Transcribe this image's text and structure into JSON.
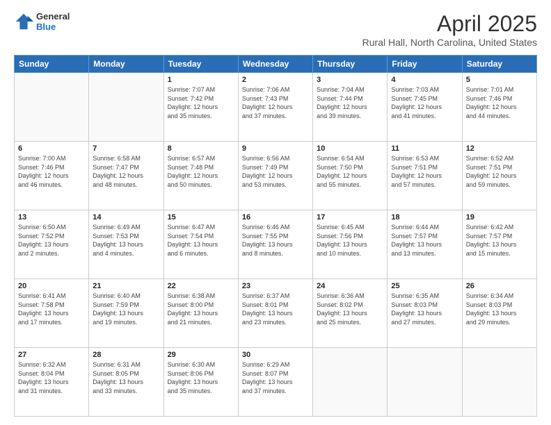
{
  "header": {
    "logo": {
      "general": "General",
      "blue": "Blue"
    },
    "title": "April 2025",
    "subtitle": "Rural Hall, North Carolina, United States"
  },
  "days_of_week": [
    "Sunday",
    "Monday",
    "Tuesday",
    "Wednesday",
    "Thursday",
    "Friday",
    "Saturday"
  ],
  "weeks": [
    [
      {
        "day": "",
        "info": ""
      },
      {
        "day": "",
        "info": ""
      },
      {
        "day": "1",
        "info": "Sunrise: 7:07 AM\nSunset: 7:42 PM\nDaylight: 12 hours\nand 35 minutes."
      },
      {
        "day": "2",
        "info": "Sunrise: 7:06 AM\nSunset: 7:43 PM\nDaylight: 12 hours\nand 37 minutes."
      },
      {
        "day": "3",
        "info": "Sunrise: 7:04 AM\nSunset: 7:44 PM\nDaylight: 12 hours\nand 39 minutes."
      },
      {
        "day": "4",
        "info": "Sunrise: 7:03 AM\nSunset: 7:45 PM\nDaylight: 12 hours\nand 41 minutes."
      },
      {
        "day": "5",
        "info": "Sunrise: 7:01 AM\nSunset: 7:46 PM\nDaylight: 12 hours\nand 44 minutes."
      }
    ],
    [
      {
        "day": "6",
        "info": "Sunrise: 7:00 AM\nSunset: 7:46 PM\nDaylight: 12 hours\nand 46 minutes."
      },
      {
        "day": "7",
        "info": "Sunrise: 6:58 AM\nSunset: 7:47 PM\nDaylight: 12 hours\nand 48 minutes."
      },
      {
        "day": "8",
        "info": "Sunrise: 6:57 AM\nSunset: 7:48 PM\nDaylight: 12 hours\nand 50 minutes."
      },
      {
        "day": "9",
        "info": "Sunrise: 6:56 AM\nSunset: 7:49 PM\nDaylight: 12 hours\nand 53 minutes."
      },
      {
        "day": "10",
        "info": "Sunrise: 6:54 AM\nSunset: 7:50 PM\nDaylight: 12 hours\nand 55 minutes."
      },
      {
        "day": "11",
        "info": "Sunrise: 6:53 AM\nSunset: 7:51 PM\nDaylight: 12 hours\nand 57 minutes."
      },
      {
        "day": "12",
        "info": "Sunrise: 6:52 AM\nSunset: 7:51 PM\nDaylight: 12 hours\nand 59 minutes."
      }
    ],
    [
      {
        "day": "13",
        "info": "Sunrise: 6:50 AM\nSunset: 7:52 PM\nDaylight: 13 hours\nand 2 minutes."
      },
      {
        "day": "14",
        "info": "Sunrise: 6:49 AM\nSunset: 7:53 PM\nDaylight: 13 hours\nand 4 minutes."
      },
      {
        "day": "15",
        "info": "Sunrise: 6:47 AM\nSunset: 7:54 PM\nDaylight: 13 hours\nand 6 minutes."
      },
      {
        "day": "16",
        "info": "Sunrise: 6:46 AM\nSunset: 7:55 PM\nDaylight: 13 hours\nand 8 minutes."
      },
      {
        "day": "17",
        "info": "Sunrise: 6:45 AM\nSunset: 7:56 PM\nDaylight: 13 hours\nand 10 minutes."
      },
      {
        "day": "18",
        "info": "Sunrise: 6:44 AM\nSunset: 7:57 PM\nDaylight: 13 hours\nand 13 minutes."
      },
      {
        "day": "19",
        "info": "Sunrise: 6:42 AM\nSunset: 7:57 PM\nDaylight: 13 hours\nand 15 minutes."
      }
    ],
    [
      {
        "day": "20",
        "info": "Sunrise: 6:41 AM\nSunset: 7:58 PM\nDaylight: 13 hours\nand 17 minutes."
      },
      {
        "day": "21",
        "info": "Sunrise: 6:40 AM\nSunset: 7:59 PM\nDaylight: 13 hours\nand 19 minutes."
      },
      {
        "day": "22",
        "info": "Sunrise: 6:38 AM\nSunset: 8:00 PM\nDaylight: 13 hours\nand 21 minutes."
      },
      {
        "day": "23",
        "info": "Sunrise: 6:37 AM\nSunset: 8:01 PM\nDaylight: 13 hours\nand 23 minutes."
      },
      {
        "day": "24",
        "info": "Sunrise: 6:36 AM\nSunset: 8:02 PM\nDaylight: 13 hours\nand 25 minutes."
      },
      {
        "day": "25",
        "info": "Sunrise: 6:35 AM\nSunset: 8:03 PM\nDaylight: 13 hours\nand 27 minutes."
      },
      {
        "day": "26",
        "info": "Sunrise: 6:34 AM\nSunset: 8:03 PM\nDaylight: 13 hours\nand 29 minutes."
      }
    ],
    [
      {
        "day": "27",
        "info": "Sunrise: 6:32 AM\nSunset: 8:04 PM\nDaylight: 13 hours\nand 31 minutes."
      },
      {
        "day": "28",
        "info": "Sunrise: 6:31 AM\nSunset: 8:05 PM\nDaylight: 13 hours\nand 33 minutes."
      },
      {
        "day": "29",
        "info": "Sunrise: 6:30 AM\nSunset: 8:06 PM\nDaylight: 13 hours\nand 35 minutes."
      },
      {
        "day": "30",
        "info": "Sunrise: 6:29 AM\nSunset: 8:07 PM\nDaylight: 13 hours\nand 37 minutes."
      },
      {
        "day": "",
        "info": ""
      },
      {
        "day": "",
        "info": ""
      },
      {
        "day": "",
        "info": ""
      }
    ]
  ]
}
